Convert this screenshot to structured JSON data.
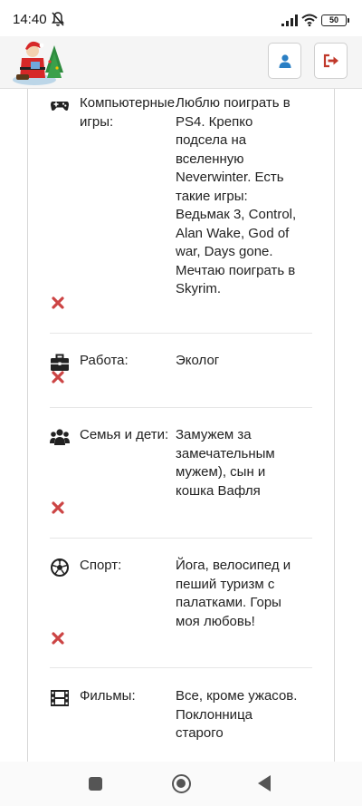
{
  "status": {
    "time": "14:40",
    "battery": "50"
  },
  "header": {
    "logo": "santa-logo",
    "user_button_icon": "user-icon",
    "logout_button_icon": "logout-icon"
  },
  "colors": {
    "header_button_user": "#2a7fc4",
    "header_button_logout": "#c0392b",
    "delete": "#cc4444"
  },
  "profile_rows": [
    {
      "icon": "gamepad-icon",
      "label": "Компьютерные игры:",
      "value": "Люблю поиграть в PS4. Крепко подсела на вселенную Neverwinter. Есть такие игры: Ведьмак 3, Control, Alan Wake, God of war, Days gone. Мечтаю поиграть в Skyrim."
    },
    {
      "icon": "briefcase-icon",
      "label": "Работа:",
      "value": "Эколог"
    },
    {
      "icon": "family-icon",
      "label": "Семья и дети:",
      "value": "Замужем за замечательным мужем), сын и кошка Вафля"
    },
    {
      "icon": "football-icon",
      "label": "Спорт:",
      "value": "Йога, велосипед и пеший туризм с палатками. Горы моя любовь!"
    },
    {
      "icon": "film-icon",
      "label": "Фильмы:",
      "value": "Все, кроме ужасов. Поклонница старого"
    }
  ]
}
